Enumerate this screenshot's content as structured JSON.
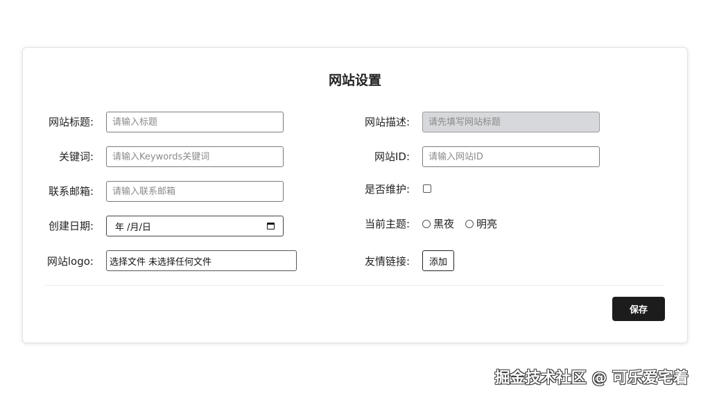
{
  "form": {
    "title": "网站设置",
    "site_title": {
      "label": "网站标题:",
      "placeholder": "请输入标题"
    },
    "keywords": {
      "label": "关键词:",
      "placeholder": "请输入Keywords关键词"
    },
    "email": {
      "label": "联系邮箱:",
      "placeholder": "请输入联系邮箱"
    },
    "create_date": {
      "label": "创建日期:",
      "value": "年 /月/日"
    },
    "logo": {
      "label": "网站logo:",
      "button": "选择文件",
      "status": "未选择任何文件"
    },
    "description": {
      "label": "网站描述:",
      "placeholder": "请先填写网站标题"
    },
    "site_id": {
      "label": "网站ID:",
      "placeholder": "请输入网站ID"
    },
    "maintenance": {
      "label": "是否维护:"
    },
    "theme": {
      "label": "当前主题:",
      "options": [
        "黑夜",
        "明亮"
      ]
    },
    "friend_links": {
      "label": "友情链接:",
      "add_button": "添加"
    },
    "save_button": "保存"
  },
  "watermark": "掘金技术社区 @ 可乐爱宅着"
}
